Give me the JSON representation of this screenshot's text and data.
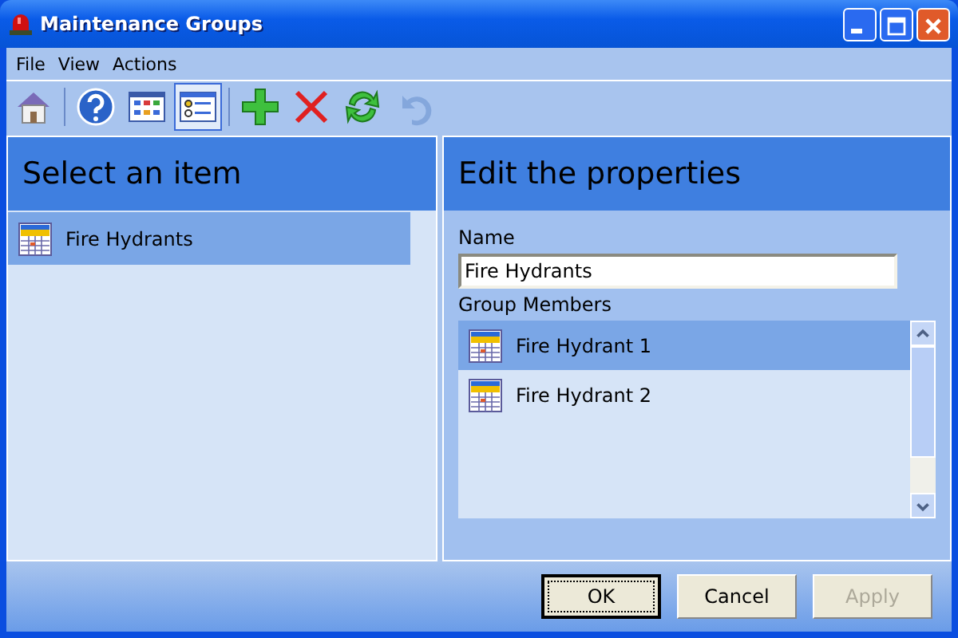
{
  "window": {
    "title": "Maintenance Groups"
  },
  "menu": [
    "File",
    "View",
    "Actions"
  ],
  "toolbar": [
    {
      "kind": "home",
      "selected": false,
      "disabled": false
    },
    {
      "kind": "separator"
    },
    {
      "kind": "help",
      "selected": false,
      "disabled": false
    },
    {
      "kind": "grid",
      "selected": false,
      "disabled": false
    },
    {
      "kind": "form",
      "selected": true,
      "disabled": false
    },
    {
      "kind": "separator"
    },
    {
      "kind": "add",
      "selected": false,
      "disabled": false
    },
    {
      "kind": "delete",
      "selected": false,
      "disabled": false
    },
    {
      "kind": "refresh",
      "selected": false,
      "disabled": false
    },
    {
      "kind": "undo",
      "selected": false,
      "disabled": true
    }
  ],
  "left_panel": {
    "header": "Select an item",
    "items": [
      {
        "label": "Fire Hydrants",
        "selected": true
      }
    ]
  },
  "right_panel": {
    "header": "Edit the properties",
    "name_label": "Name",
    "name_value": "Fire Hydrants",
    "members_label": "Group Members",
    "members": [
      {
        "label": "Fire Hydrant 1",
        "selected": true
      },
      {
        "label": "Fire Hydrant 2",
        "selected": false
      }
    ]
  },
  "buttons": [
    {
      "label": "OK",
      "default": true,
      "disabled": false
    },
    {
      "label": "Cancel",
      "default": false,
      "disabled": false
    },
    {
      "label": "Apply",
      "default": false,
      "disabled": true
    }
  ]
}
